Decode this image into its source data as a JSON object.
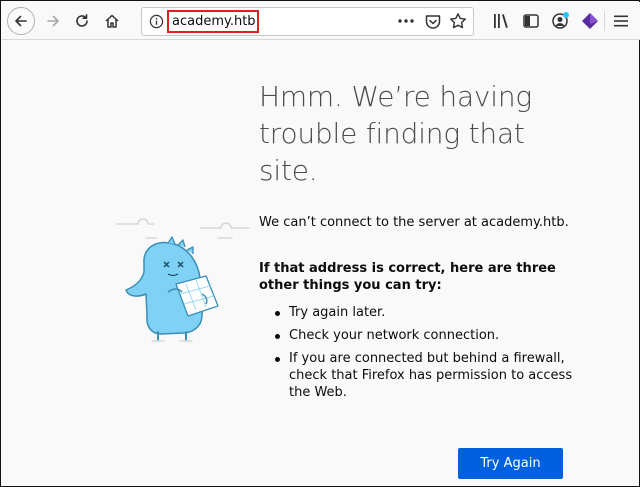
{
  "toolbar": {
    "url": "academy.htb",
    "icons": [
      "back-icon",
      "forward-icon",
      "reload-icon",
      "home-icon",
      "info-icon",
      "more-dots-icon",
      "pocket-icon",
      "star-icon",
      "library-icon",
      "sidebar-icon",
      "account-icon",
      "extension-icon",
      "menu-icon"
    ]
  },
  "page": {
    "title": "Hmm. We’re having trouble finding that site.",
    "lead": "We can’t connect to the server at academy.htb.",
    "subhead": "If that address is correct, here are three other things you can try:",
    "tips": [
      "Try again later.",
      "Check your network connection.",
      "If you are connected but behind a firewall, check that Firefox has permission to access the Web."
    ],
    "try_again_label": "Try Again"
  },
  "colors": {
    "accent": "#0060df",
    "url_highlight": "#e02020",
    "illustration": "#7fd1f5"
  }
}
